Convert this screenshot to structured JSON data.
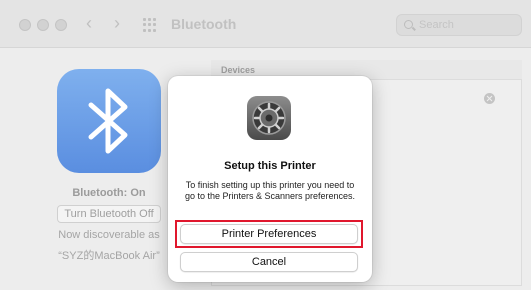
{
  "window": {
    "title": "Bluetooth",
    "search_placeholder": "Search"
  },
  "bluetooth": {
    "status": "Bluetooth: On",
    "toggle_label": "Turn Bluetooth Off",
    "discoverable_label": "Now discoverable as",
    "device_name": "“SYZ的MacBook Air”"
  },
  "devices": {
    "header": "Devices"
  },
  "dialog": {
    "title": "Setup this Printer",
    "message": "To finish setting up this printer you need to go to the Printers & Scanners preferences.",
    "primary_label": "Printer Preferences",
    "cancel_label": "Cancel",
    "highlight_color": "#e0172d"
  },
  "icons": {
    "app": "system-preferences-gear-icon",
    "bluetooth": "bluetooth-icon"
  }
}
